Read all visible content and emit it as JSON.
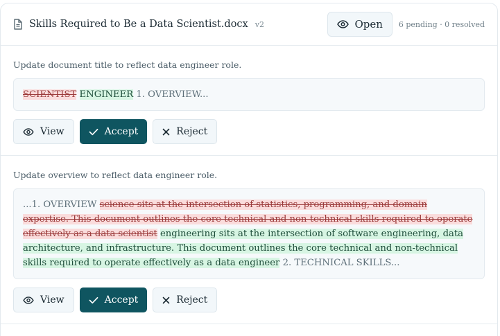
{
  "header": {
    "doc_title": "Skills Required to Be a Data Scientist.docx",
    "version": "v2",
    "open_label": "Open",
    "status": "6 pending · 0 resolved"
  },
  "changes": [
    {
      "description": "Update document title to reflect data engineer role.",
      "deleted": "SCIENTIST",
      "inserted": "ENGINEER",
      "context_before": "",
      "context_after": "1. OVERVIEW..."
    },
    {
      "description": "Update overview to reflect data engineer role.",
      "context_before": "...1. OVERVIEW",
      "deleted": "science sits at the intersection of statistics, programming, and domain expertise. This document outlines the core technical and non-technical skills required to operate effectively as a data scientist",
      "inserted": "engineering sits at the intersection of software engineering, data architecture, and infrastructure. This document outlines the core technical and non-technical skills required to operate effectively as a data engineer",
      "context_after": "2. TECHNICAL SKILLS..."
    }
  ],
  "actions": {
    "view_label": "View",
    "accept_label": "Accept",
    "reject_label": "Reject"
  },
  "icons": {
    "doc": "document-icon",
    "eye": "eye-icon",
    "check": "check-icon",
    "x": "close-icon"
  },
  "colors": {
    "accent": "#0f5560",
    "deletion_bg": "#fadcdc",
    "insertion_bg": "#d7f5e3"
  }
}
